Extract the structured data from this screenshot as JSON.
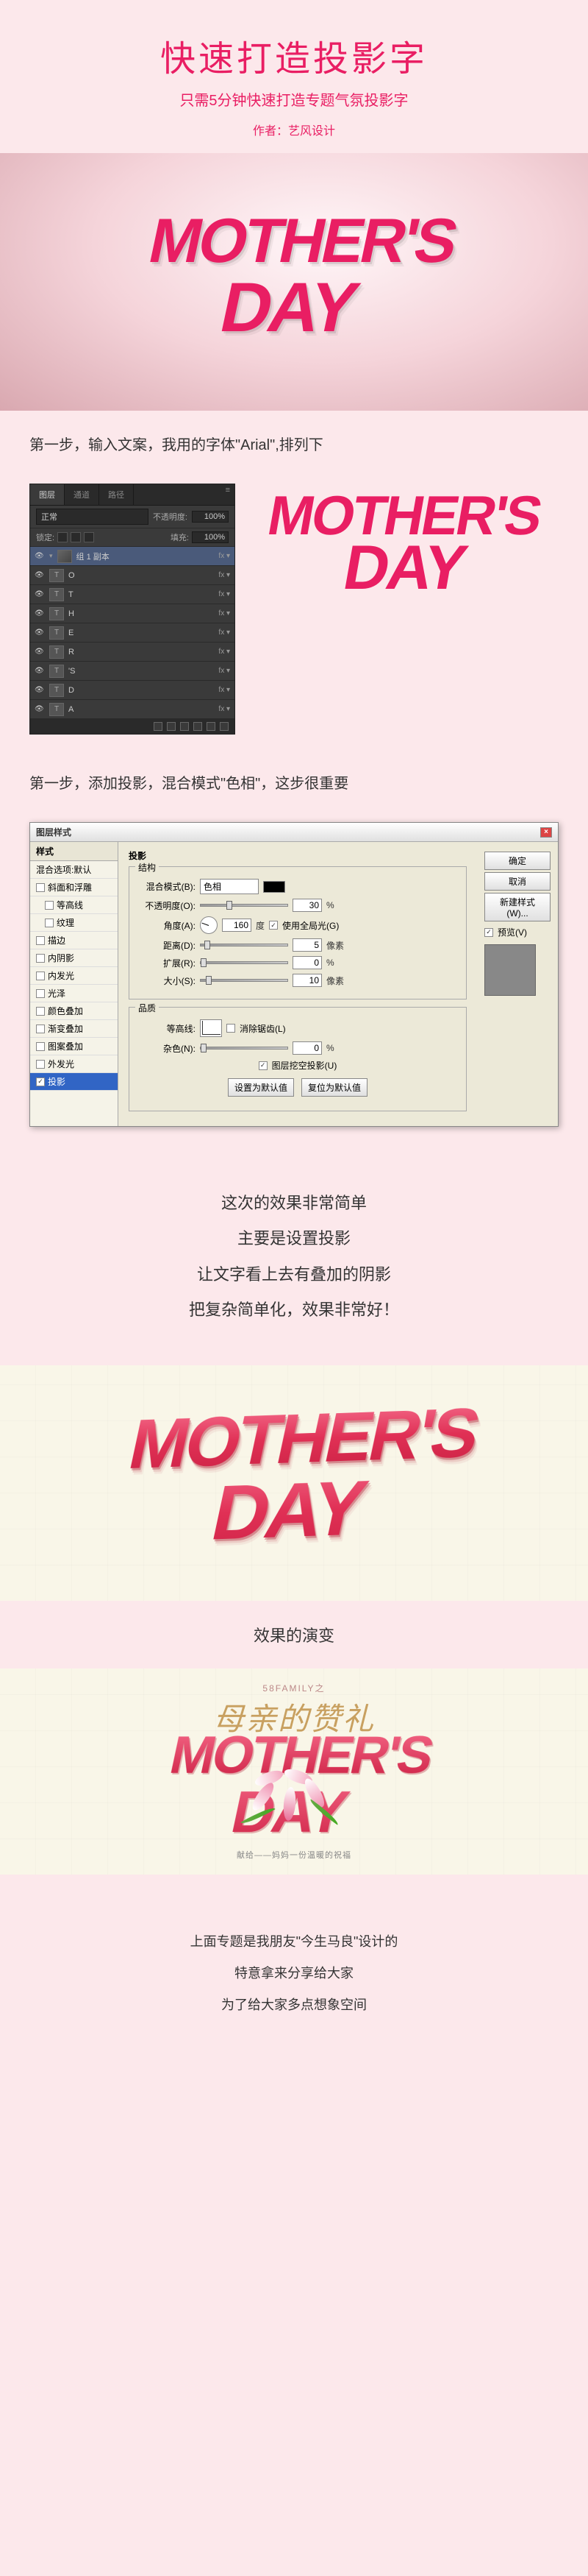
{
  "header": {
    "title": "快速打造投影字",
    "subtitle": "只需5分钟快速打造专题气氛投影字",
    "author_label": "作者：艺风设计"
  },
  "hero": {
    "line1": "MOTHER'S",
    "line2": "DAY"
  },
  "step1": {
    "text": "第一步，输入文案，我用的字体\"Arial\",排列下",
    "art_line1": "MOTHER'S",
    "art_line2": "DAY"
  },
  "layers_panel": {
    "tabs": [
      "图层",
      "通道",
      "路径"
    ],
    "menu_icon": "≡",
    "mode_label": "正常",
    "opacity_label": "不透明度:",
    "opacity_value": "100%",
    "lock_label": "锁定:",
    "fill_label": "填充:",
    "fill_value": "100%",
    "layers": [
      {
        "name": "组 1 副本",
        "type": "group",
        "selected": true,
        "fx": "fx ▾"
      },
      {
        "name": "T",
        "type": "text",
        "sub": "O"
      },
      {
        "name": "T",
        "type": "text",
        "sub": "T"
      },
      {
        "name": "T",
        "type": "text",
        "sub": "H"
      },
      {
        "name": "T",
        "type": "text",
        "sub": "E"
      },
      {
        "name": "T",
        "type": "text",
        "sub": "R"
      },
      {
        "name": "T",
        "type": "text",
        "sub": "'S"
      },
      {
        "name": "T",
        "type": "text",
        "sub": "D"
      },
      {
        "name": "T",
        "type": "text",
        "sub": "A"
      }
    ]
  },
  "step2": {
    "text": "第一步，添加投影，混合模式\"色相\"，这步很重要"
  },
  "dialog": {
    "title": "图层样式",
    "left_header": "样式",
    "blend_default": "混合选项:默认",
    "styles": [
      {
        "name": "斜面和浮雕",
        "checked": false
      },
      {
        "name": "等高线",
        "checked": false,
        "indent": true
      },
      {
        "name": "纹理",
        "checked": false,
        "indent": true
      },
      {
        "name": "描边",
        "checked": false
      },
      {
        "name": "内阴影",
        "checked": false
      },
      {
        "name": "内发光",
        "checked": false
      },
      {
        "name": "光泽",
        "checked": false
      },
      {
        "name": "颜色叠加",
        "checked": false
      },
      {
        "name": "渐变叠加",
        "checked": false
      },
      {
        "name": "图案叠加",
        "checked": false
      },
      {
        "name": "外发光",
        "checked": false
      },
      {
        "name": "投影",
        "checked": true,
        "selected": true
      }
    ],
    "section_title": "投影",
    "fieldset_struct": "结构",
    "blend_mode_label": "混合模式(B):",
    "blend_mode_value": "色相",
    "opacity_label": "不透明度(O):",
    "opacity_value": "30",
    "opacity_unit": "%",
    "angle_label": "角度(A):",
    "angle_value": "160",
    "angle_unit": "度",
    "global_light": "使用全局光(G)",
    "distance_label": "距离(D):",
    "distance_value": "5",
    "distance_unit": "像素",
    "spread_label": "扩展(R):",
    "spread_value": "0",
    "spread_unit": "%",
    "size_label": "大小(S):",
    "size_value": "10",
    "size_unit": "像素",
    "fieldset_quality": "品质",
    "contour_label": "等高线:",
    "antialias": "消除锯齿(L)",
    "noise_label": "杂色(N):",
    "noise_value": "0",
    "noise_unit": "%",
    "knockout": "图层挖空投影(U)",
    "btn_default": "设置为默认值",
    "btn_reset": "复位为默认值",
    "btn_ok": "确定",
    "btn_cancel": "取消",
    "btn_new_style": "新建样式(W)...",
    "preview_check": "预览(V)"
  },
  "summary": {
    "l1": "这次的效果非常简单",
    "l2": "主要是设置投影",
    "l3": "让文字看上去有叠加的阴影",
    "l4": "把复杂简单化，效果非常好！"
  },
  "result1": {
    "line1": "MOTHER'S",
    "line2": "DAY"
  },
  "evolve": "效果的演变",
  "result2": {
    "badge": "58FAMILY之",
    "chinese": "母亲的赞礼",
    "line1": "MOTHER'S",
    "line2": "DAY",
    "sub": "献给——妈妈一份温暖的祝福"
  },
  "footer": {
    "l1": "上面专题是我朋友\"今生马良\"设计的",
    "l2": "特意拿来分享给大家",
    "l3": "为了给大家多点想象空间"
  }
}
